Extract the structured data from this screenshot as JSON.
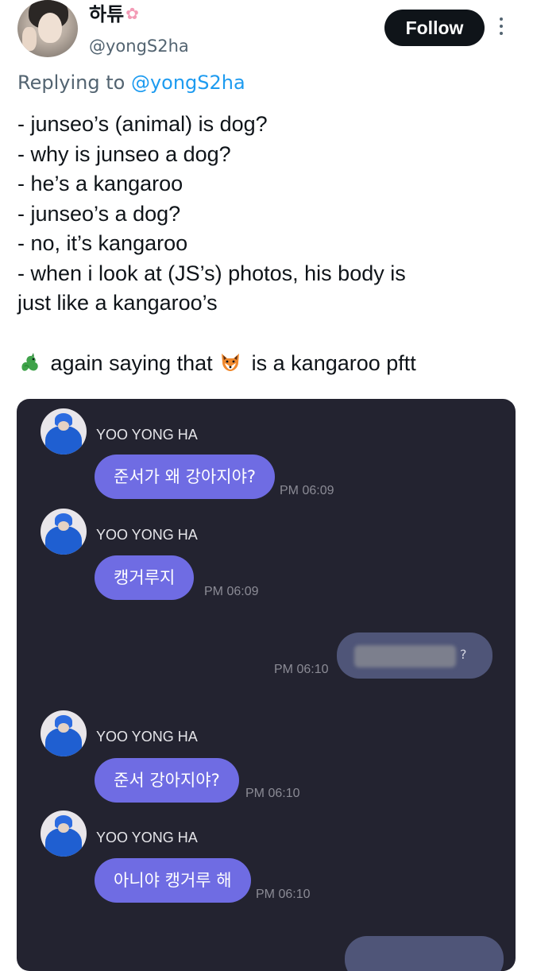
{
  "header": {
    "display_name": "하튜",
    "name_emoji_icon": "cherry-blossom-icon",
    "handle": "@yongS2ha",
    "follow_label": "Follow",
    "more_icon": "more-vertical-icon"
  },
  "reply": {
    "prefix": "Replying to ",
    "mention": "@yongS2ha"
  },
  "tweet": {
    "lines": [
      "- junseo’s (animal) is dog?",
      "- why is junseo a dog?",
      "- he’s a kangaroo",
      "- junseo’s a dog?",
      "- no, it’s kangaroo",
      "- when i look at (JS’s) photos, his body is",
      "just like a kangaroo’s"
    ],
    "final": {
      "emoji1_icon": "dragon-icon",
      "part1": " again saying that ",
      "emoji2_icon": "fox-icon",
      "part2": " is a kangaroo pftt"
    }
  },
  "chat": {
    "colors": {
      "background": "#232330",
      "incoming_bubble": "#6f6ce3",
      "outgoing_bubble": "#4f5578"
    },
    "messages": [
      {
        "sender": "YOO YONG HA",
        "text": "준서가 왜 강아지야?",
        "time": "PM 06:09"
      },
      {
        "sender": "YOO YONG HA",
        "text": "캥거루지",
        "time": "PM 06:09"
      },
      {
        "outgoing": true,
        "visible_text": "?",
        "time": "PM 06:10"
      },
      {
        "sender": "YOO YONG HA",
        "text": "준서 강아지야?",
        "time": "PM 06:10"
      },
      {
        "sender": "YOO YONG HA",
        "text": "아니야 캥거루 해",
        "time": "PM 06:10"
      }
    ]
  }
}
